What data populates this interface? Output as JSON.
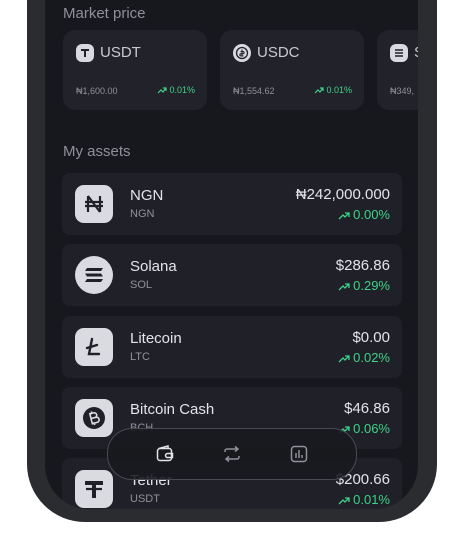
{
  "market": {
    "title": "Market price",
    "cards": [
      {
        "symbol": "USDT",
        "price": "₦1,600.00",
        "change": "0.01%",
        "icon": "tether-icon"
      },
      {
        "symbol": "USDC",
        "price": "₦1,554.62",
        "change": "0.01%",
        "icon": "usdc-icon"
      },
      {
        "symbol": "S",
        "price": "₦349,",
        "change": "",
        "icon": "solana-icon"
      }
    ]
  },
  "assets": {
    "title": "My assets",
    "items": [
      {
        "name": "NGN",
        "symbol": "NGN",
        "value": "₦242,000.000",
        "change": "0.00%",
        "icon": "naira-icon"
      },
      {
        "name": "Solana",
        "symbol": "SOL",
        "value": "$286.86",
        "change": "0.29%",
        "icon": "solana-icon"
      },
      {
        "name": "Litecoin",
        "symbol": "LTC",
        "value": "$0.00",
        "change": "0.02%",
        "icon": "litecoin-icon"
      },
      {
        "name": "Bitcoin Cash",
        "symbol": "BCH",
        "value": "$46.86",
        "change": "0.06%",
        "icon": "bitcoin-cash-icon"
      },
      {
        "name": "Tether",
        "symbol": "USDT",
        "value": "$200.66",
        "change": "0.01%",
        "icon": "tether-icon"
      }
    ]
  },
  "nav": {
    "items": [
      {
        "icon": "wallet-icon"
      },
      {
        "icon": "swap-icon"
      },
      {
        "icon": "chart-icon"
      }
    ]
  },
  "colors": {
    "background": "#17181d",
    "card": "#202128",
    "positive": "#3ed28a",
    "text": "#e3e4e8",
    "muted": "#8f9099"
  }
}
